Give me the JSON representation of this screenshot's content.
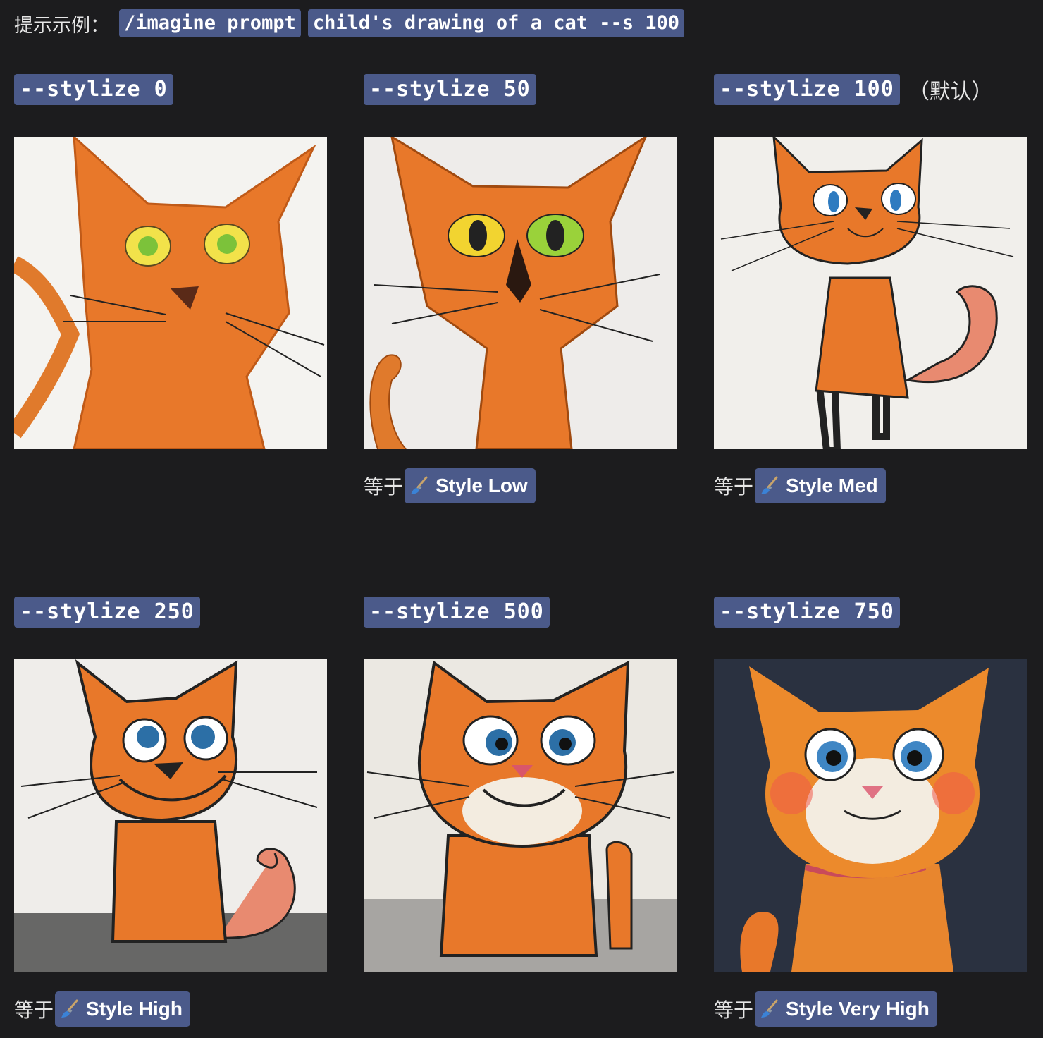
{
  "prompt": {
    "label": "提示示例：",
    "command": "/imagine prompt",
    "text": "child's drawing of a cat --s 100"
  },
  "cells": [
    {
      "param": "--stylize 0",
      "suffix": "",
      "eq": "",
      "badge": ""
    },
    {
      "param": "--stylize 50",
      "suffix": "",
      "eq": "等于",
      "badge": "Style Low"
    },
    {
      "param": "--stylize 100",
      "suffix": "（默认）",
      "eq": "等于",
      "badge": "Style Med"
    },
    {
      "param": "--stylize 250",
      "suffix": "",
      "eq": "等于",
      "badge": "Style High"
    },
    {
      "param": "--stylize 500",
      "suffix": "",
      "eq": "",
      "badge": ""
    },
    {
      "param": "--stylize 750",
      "suffix": "",
      "eq": "等于",
      "badge": "Style Very High"
    }
  ],
  "icons": {
    "style_badge": "paintbrush-icon"
  },
  "colors": {
    "background": "#1c1c1e",
    "code_bg": "#4b5a8a",
    "cat_orange": "#e8782a"
  }
}
